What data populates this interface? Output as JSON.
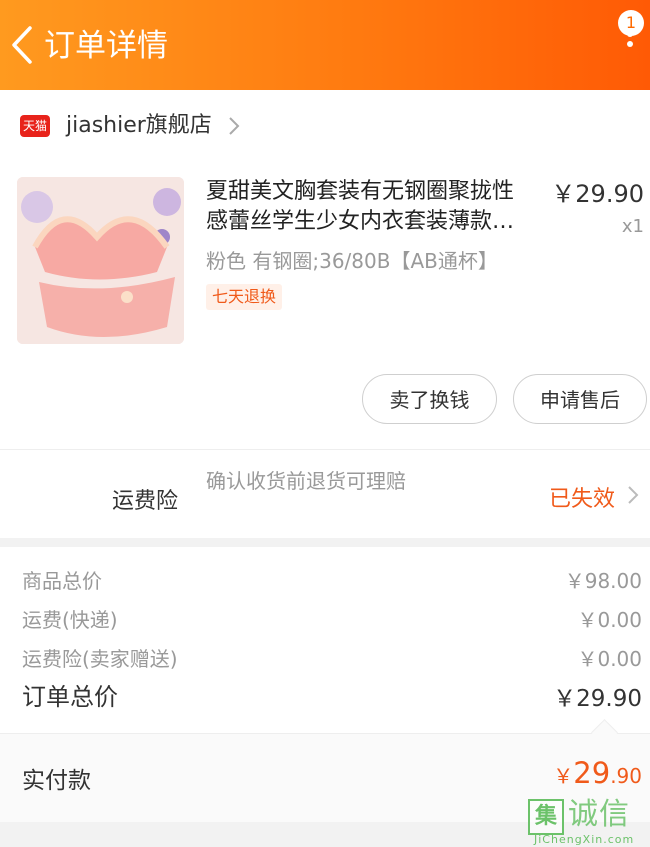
{
  "header": {
    "title": "订单详情",
    "badge_count": "1",
    "gradient_colors": [
      "#ff9a1f",
      "#ff5a05"
    ]
  },
  "store": {
    "tmall_label": "天猫",
    "name": "jiashier旗舰店"
  },
  "product": {
    "title_line1": "夏甜美文胸套装有无钢圈聚拢性",
    "title_line2": "感蕾丝学生少女内衣套装薄款…",
    "price": "￥29.90",
    "quantity": "x1",
    "sku": "粉色 有钢圈;36/80B【AB通杯】",
    "return_tag": "七天退换",
    "image_icon": "lingerie-product-image"
  },
  "actions": {
    "sell_label": "卖了换钱",
    "after_sale_label": "申请售后"
  },
  "insurance": {
    "label": "运费险",
    "description": "确认收货前退货可理赔",
    "status": "已失效"
  },
  "summary": {
    "rows": [
      {
        "label": "商品总价",
        "value": "￥98.00"
      },
      {
        "label": "运费(快递)",
        "value": "￥0.00"
      },
      {
        "label": "运费险(卖家赠送)",
        "value": "￥0.00"
      }
    ],
    "total_label": "订单总价",
    "total_value": "￥29.90"
  },
  "payment": {
    "label": "实付款",
    "symbol": "￥",
    "amount_int": "29",
    "amount_dec": ".90"
  },
  "watermark": {
    "box_char": "集",
    "text": "诚信",
    "sub": "JiChengXin.com"
  },
  "colors": {
    "accent": "#f05a1a",
    "tmall_red": "#e8231b"
  }
}
